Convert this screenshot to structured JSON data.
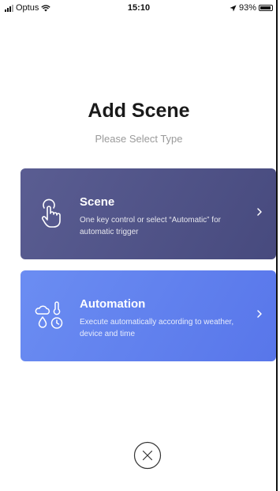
{
  "status_bar": {
    "carrier": "Optus",
    "time": "15:10",
    "battery": "93%",
    "icons": [
      "signal-icon",
      "wifi-icon",
      "location-arrow-icon",
      "battery-icon"
    ]
  },
  "header": {
    "title": "Add Scene",
    "subtitle": "Please Select Type"
  },
  "cards": [
    {
      "title": "Scene",
      "description": "One key control or select “Automatic” for automatic trigger",
      "icon": "hand-tap-icon",
      "color": "#4f5286"
    },
    {
      "title": "Automation",
      "description": "Execute automatically according to weather, device and time",
      "icon": "weather-time-icon",
      "color": "#6281ee"
    }
  ],
  "footer": {
    "close_icon": "close-circle-icon"
  }
}
